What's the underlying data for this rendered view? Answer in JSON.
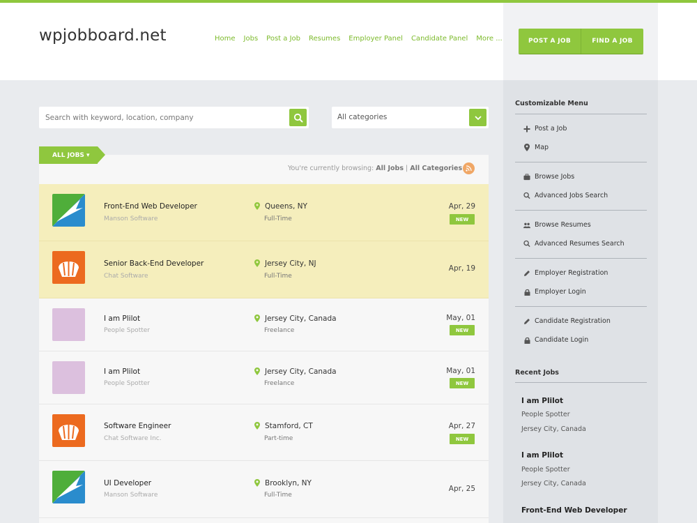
{
  "site": {
    "logo": "wpjobboard.net"
  },
  "nav": [
    "Home",
    "Jobs",
    "Post a Job",
    "Resumes",
    "Employer Panel",
    "Candidate Panel",
    "More ..."
  ],
  "header_buttons": {
    "post": "POST A JOB",
    "find": "FIND A JOB"
  },
  "search": {
    "placeholder": "Search with keyword, location, company"
  },
  "category": {
    "selected": "All categories"
  },
  "tab": {
    "label": "ALL JOBS ▾"
  },
  "browsing": {
    "prefix": "You're currently browsing:",
    "jobs": "All Jobs",
    "sep": " | ",
    "cats": "All Categories"
  },
  "jobs": [
    {
      "title": "Front-End Web Developer",
      "company": "Manson Software",
      "location": "Queens, NY",
      "type": "Full-Time",
      "date": "Apr, 29",
      "badge": "NEW"
    },
    {
      "title": "Senior Back-End Developer",
      "company": "Chat Software",
      "location": "Jersey City, NJ",
      "type": "Full-Time",
      "date": "Apr, 19",
      "badge": ""
    },
    {
      "title": "I am Plilot",
      "company": "People Spotter",
      "location": "Jersey City, Canada",
      "type": "Freelance",
      "date": "May, 01",
      "badge": "NEW"
    },
    {
      "title": "I am Plilot",
      "company": "People Spotter",
      "location": "Jersey City, Canada",
      "type": "Freelance",
      "date": "May, 01",
      "badge": "NEW"
    },
    {
      "title": "Software Engineer",
      "company": "Chat Software Inc.",
      "location": "Stamford, CT",
      "type": "Part-time",
      "date": "Apr, 27",
      "badge": "NEW"
    },
    {
      "title": "UI Developer",
      "company": "Manson Software",
      "location": "Brooklyn, NY",
      "type": "Full-Time",
      "date": "Apr, 25",
      "badge": ""
    }
  ],
  "sidebar": {
    "menu_title": "Customizable Menu",
    "items": [
      "Post a Job",
      "Map",
      "Browse Jobs",
      "Advanced Jobs Search",
      "Browse Resumes",
      "Advanced Resumes Search",
      "Employer Registration",
      "Employer Login",
      "Candidate Registration",
      "Candidate Login"
    ],
    "recent_title": "Recent Jobs",
    "recent": [
      {
        "title": "I am Plilot",
        "company": "People Spotter",
        "location": "Jersey City, Canada"
      },
      {
        "title": "I am Plilot",
        "company": "People Spotter",
        "location": "Jersey City, Canada"
      },
      {
        "title": "Front-End Web Developer",
        "company": "",
        "location": ""
      }
    ]
  },
  "colors": {
    "accent": "#8fc73e",
    "highlight": "#f5eebc",
    "sidebar": "#dfe2e6"
  }
}
